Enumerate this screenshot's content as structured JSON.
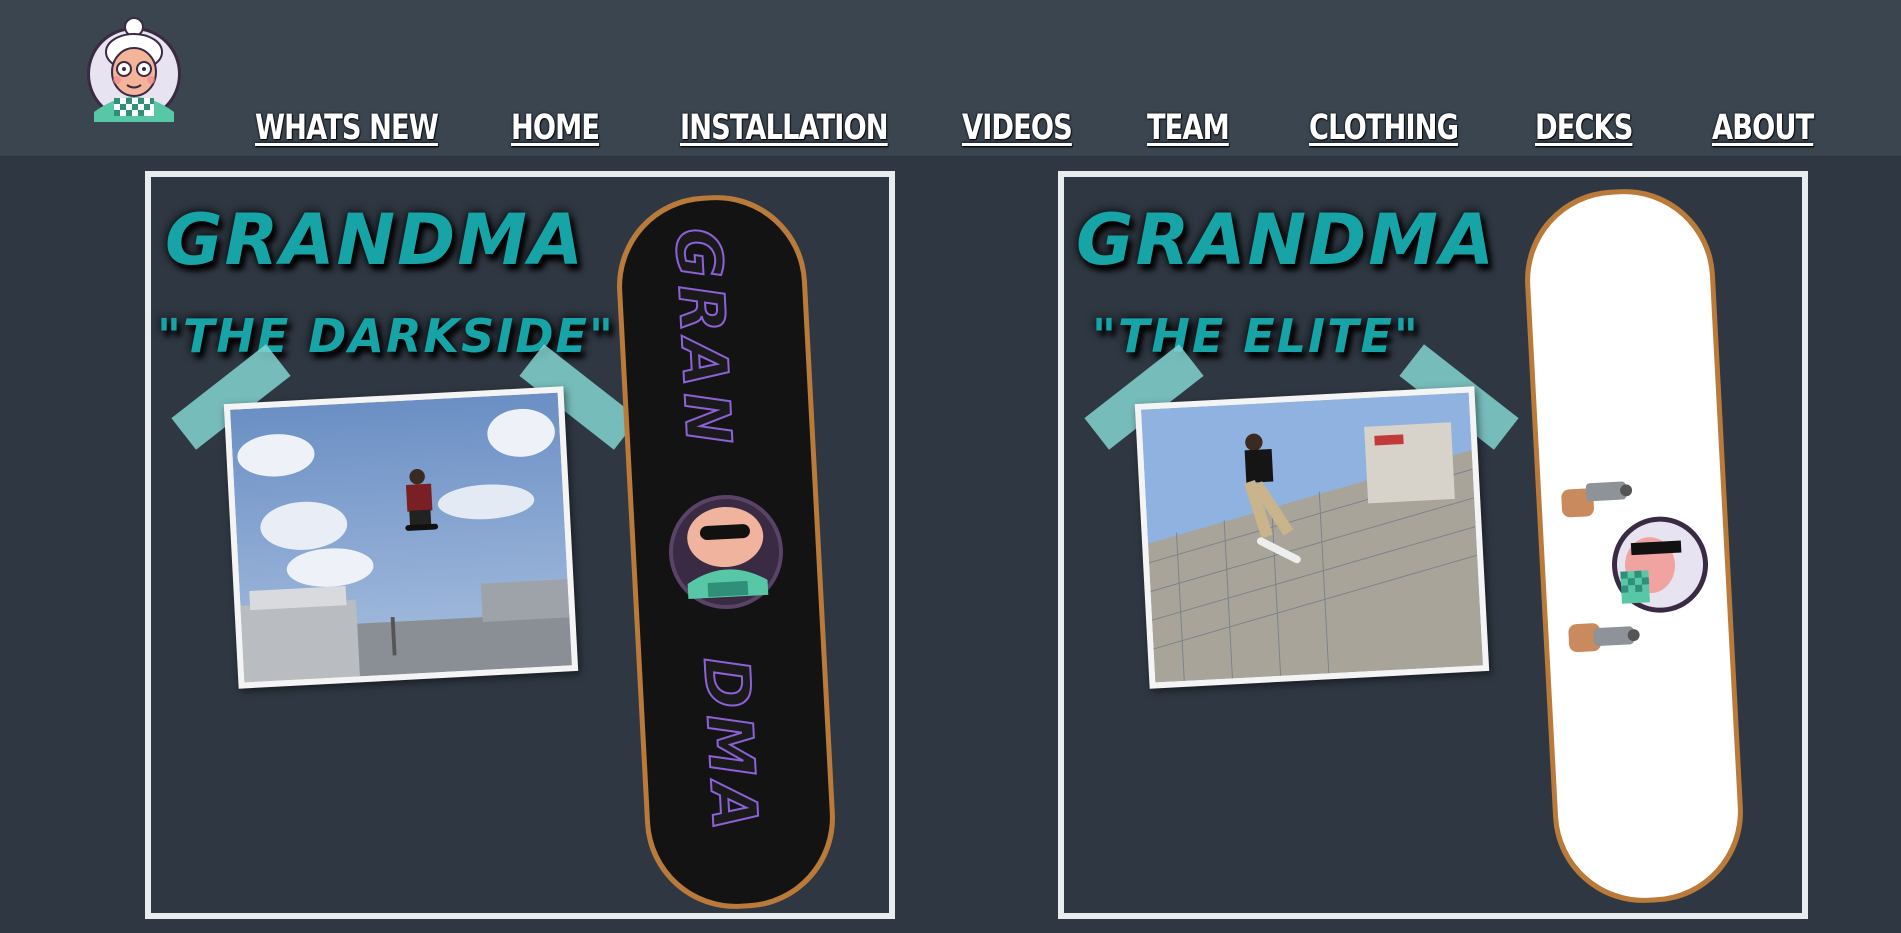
{
  "nav": {
    "items": [
      {
        "label": "WHATS NEW"
      },
      {
        "label": "HOME"
      },
      {
        "label": "INSTALLATION"
      },
      {
        "label": "VIDEOS"
      },
      {
        "label": "TEAM"
      },
      {
        "label": "CLOTHING"
      },
      {
        "label": "DECKS"
      },
      {
        "label": "ABOUT"
      }
    ]
  },
  "decks": [
    {
      "title": "GRANDMA",
      "subtitle": "\"THE DARKSIDE\"",
      "deck_text_top": "GRAN",
      "deck_text_bottom": "DMA",
      "deck_color": "#131313"
    },
    {
      "title": "GRANDMA",
      "subtitle": "\"THE ELITE\"",
      "deck_color": "#ffffff"
    }
  ],
  "colors": {
    "accent": "#16a4a6",
    "header": "#3a4550",
    "background": "#2f3742",
    "deck_edge": "#b97a3a"
  },
  "icons": {
    "logo": "grandma-logo-icon"
  }
}
